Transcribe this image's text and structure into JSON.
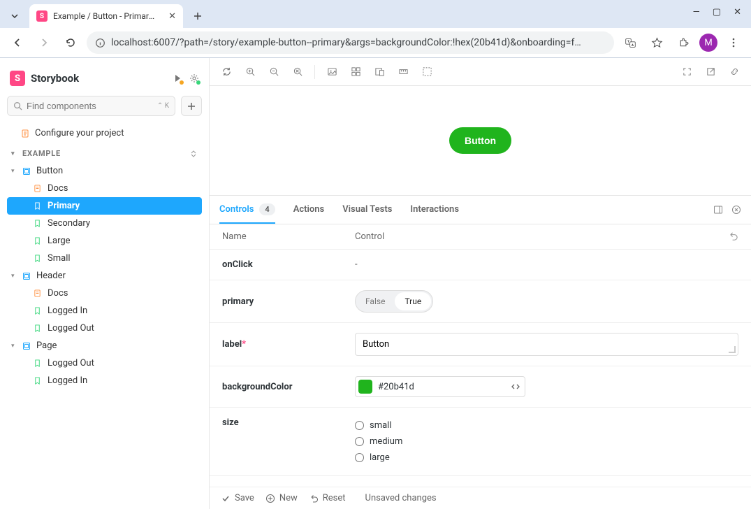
{
  "browser": {
    "tab_title": "Example / Button - Primary · S",
    "url": "localhost:6007/?path=/story/example-button--primary&args=backgroundColor:!hex(20b41d)&onboarding=f…",
    "avatar_letter": "M"
  },
  "sidebar": {
    "app_name": "Storybook",
    "search_placeholder": "Find components",
    "search_hint": "⌃ K",
    "configure_label": "Configure your project",
    "group_heading": "EXAMPLE",
    "tree": {
      "button": {
        "label": "Button",
        "docs": "Docs",
        "stories": [
          "Primary",
          "Secondary",
          "Large",
          "Small"
        ]
      },
      "header": {
        "label": "Header",
        "docs": "Docs",
        "stories": [
          "Logged In",
          "Logged Out"
        ]
      },
      "page": {
        "label": "Page",
        "stories": [
          "Logged Out",
          "Logged In"
        ]
      }
    }
  },
  "canvas": {
    "button_label": "Button",
    "button_bg": "#20b41d"
  },
  "addons": {
    "tabs": {
      "controls": "Controls",
      "controls_count": "4",
      "actions": "Actions",
      "visual_tests": "Visual Tests",
      "interactions": "Interactions"
    },
    "columns": {
      "name": "Name",
      "control": "Control"
    },
    "rows": {
      "onClick": {
        "name": "onClick",
        "control_display": "-"
      },
      "primary": {
        "name": "primary",
        "false_label": "False",
        "true_label": "True",
        "value": true
      },
      "label": {
        "name": "label",
        "required": true,
        "value": "Button"
      },
      "backgroundColor": {
        "name": "backgroundColor",
        "value": "#20b41d"
      },
      "size": {
        "name": "size",
        "options": [
          "small",
          "medium",
          "large"
        ],
        "value": null
      }
    },
    "footer": {
      "save": "Save",
      "new": "New",
      "reset": "Reset",
      "unsaved": "Unsaved changes"
    }
  }
}
